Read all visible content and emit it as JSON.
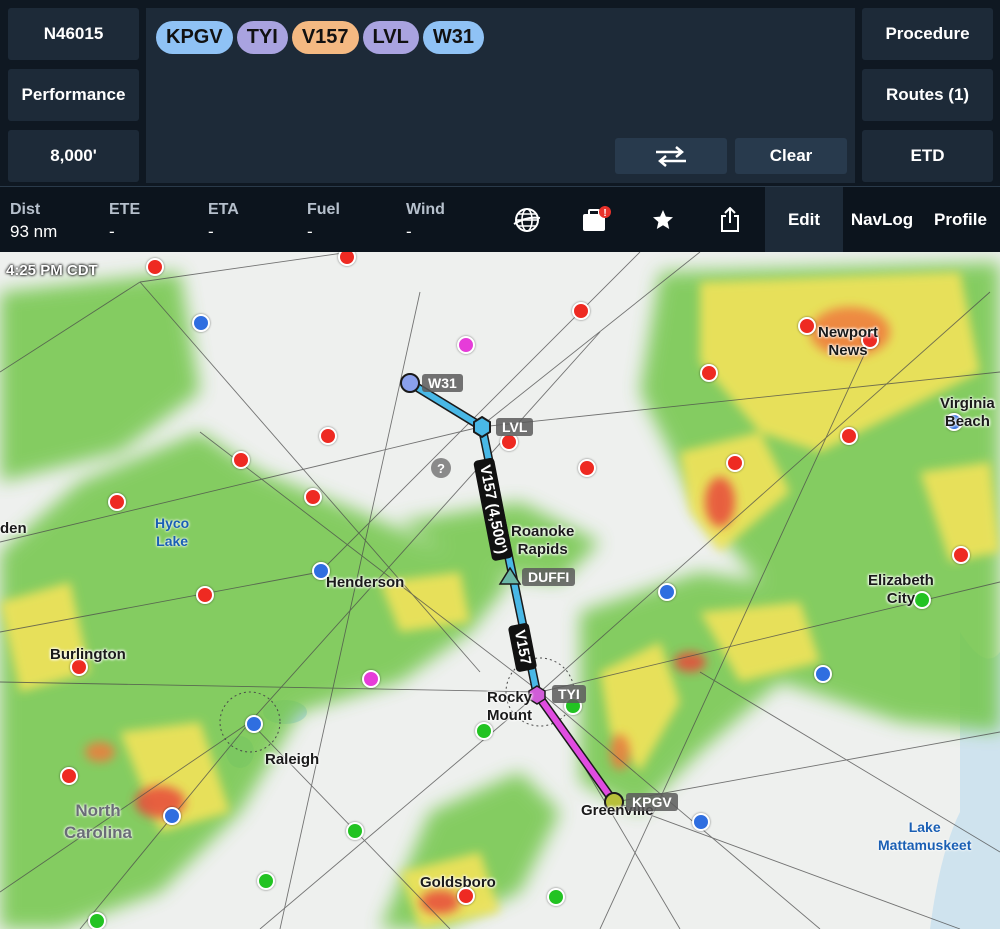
{
  "header": {
    "tail_number": "N46015",
    "performance_label": "Performance",
    "altitude": "8,000'",
    "procedure_label": "Procedure",
    "routes_label": "Routes (1)",
    "etd_label": "ETD",
    "clear_label": "Clear",
    "route_chips": [
      {
        "label": "KPGV",
        "color": "#8fc2f5"
      },
      {
        "label": "TYI",
        "color": "#a9a3e0"
      },
      {
        "label": "V157",
        "color": "#f4b982"
      },
      {
        "label": "LVL",
        "color": "#a9a3e0"
      },
      {
        "label": "W31",
        "color": "#8fc2f5"
      }
    ]
  },
  "stats": {
    "dist": {
      "label": "Dist",
      "value": "93 nm"
    },
    "ete": {
      "label": "ETE",
      "value": "-"
    },
    "eta": {
      "label": "ETA",
      "value": "-"
    },
    "fuel": {
      "label": "Fuel",
      "value": "-"
    },
    "wind": {
      "label": "Wind",
      "value": "-"
    }
  },
  "tabs": {
    "edit": "Edit",
    "navlog": "NavLog",
    "profile": "Profile"
  },
  "icons": [
    "globe-layers-icon",
    "flight-bag-icon",
    "star-icon",
    "share-icon",
    "swap-arrows-icon"
  ],
  "map": {
    "time": "4:25 PM CDT",
    "cities": {
      "newport_news": "Newport\nNews",
      "virginia_beach": "Virginia\nBeach",
      "roanoke_rapids": "Roanoke\nRapids",
      "henderson": "Henderson",
      "elizabeth_city": "Elizabeth\nCity",
      "burlington": "Burlington",
      "rocky_mount": "Rocky\nMount",
      "raleigh": "Raleigh",
      "greenville": "Greenville",
      "goldsboro": "Goldsboro",
      "den_fragment": "den"
    },
    "water": {
      "hyco_lake": "Hyco\nLake",
      "lake_mattamuskeet": "Lake\nMattamuskeet"
    },
    "state": "North\nCarolina",
    "waypoints": {
      "w31": "W31",
      "lvl": "LVL",
      "duffi": "DUFFI",
      "tyi": "TYI",
      "kpgv": "KPGV"
    },
    "legs": {
      "upper": "V157 (4,500')",
      "lower": "V157"
    },
    "colors": {
      "route_blue": "#49b8e6",
      "route_magenta": "#e04ce0",
      "vfr": "#22c322",
      "ifr": "#2f6ee0",
      "lifr": "#e63cd9",
      "mvfr_red": "#ee2a22"
    }
  }
}
